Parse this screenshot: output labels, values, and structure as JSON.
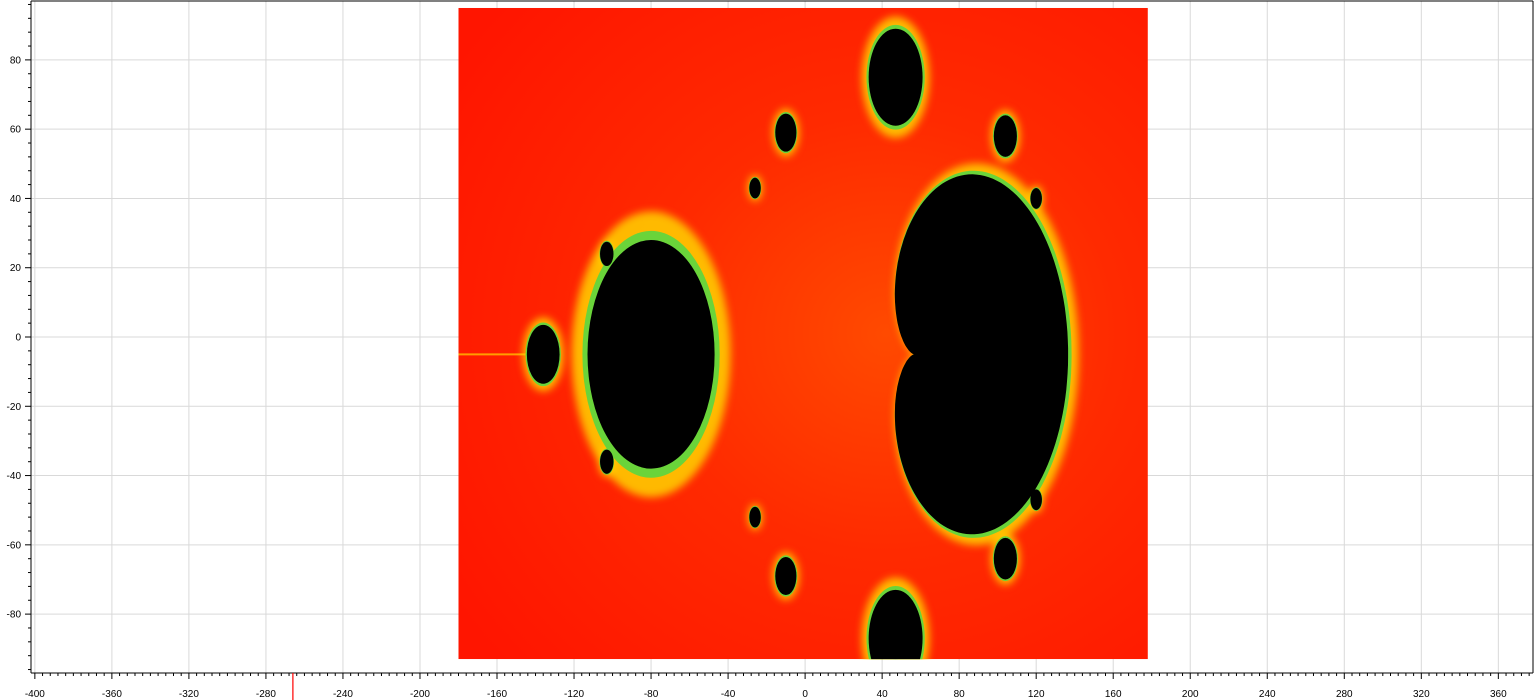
{
  "chart_data": {
    "type": "heatmap",
    "title": "",
    "xlabel": "",
    "ylabel": "",
    "xlim": [
      -402,
      378
    ],
    "ylim": [
      -97,
      97
    ],
    "x_ticks": [
      -400,
      -360,
      -320,
      -280,
      -240,
      -200,
      -160,
      -120,
      -80,
      -40,
      0,
      40,
      80,
      120,
      160,
      200,
      240,
      280,
      320,
      360
    ],
    "y_ticks": [
      80,
      60,
      40,
      20,
      0,
      -20,
      -40,
      -60,
      -80
    ],
    "x_tick_labels": [
      "-400",
      "-360",
      "-320",
      "-280",
      "-240",
      "-200",
      "-160",
      "-120",
      "-80",
      "-40",
      "0",
      "40",
      "80",
      "120",
      "160",
      "200",
      "240",
      "280",
      "320",
      "360"
    ],
    "y_tick_labels": [
      "80",
      "60",
      "40",
      "20",
      "0",
      "-20",
      "-40",
      "-60",
      "-80"
    ],
    "grid": true,
    "cursor_x": -266,
    "image": {
      "description": "Mandelbrot set fractal rendering",
      "x_extent": [
        -180,
        178
      ],
      "y_extent": [
        -93,
        95
      ],
      "colors": {
        "inside": "#000000",
        "background": "#ff1a00",
        "edge_glow": "#ffd400",
        "edge_green": "#6ad43a"
      }
    }
  },
  "colors": {
    "grid": "#d9d9d9",
    "axis": "#000000",
    "cursor": "#ff0000"
  }
}
